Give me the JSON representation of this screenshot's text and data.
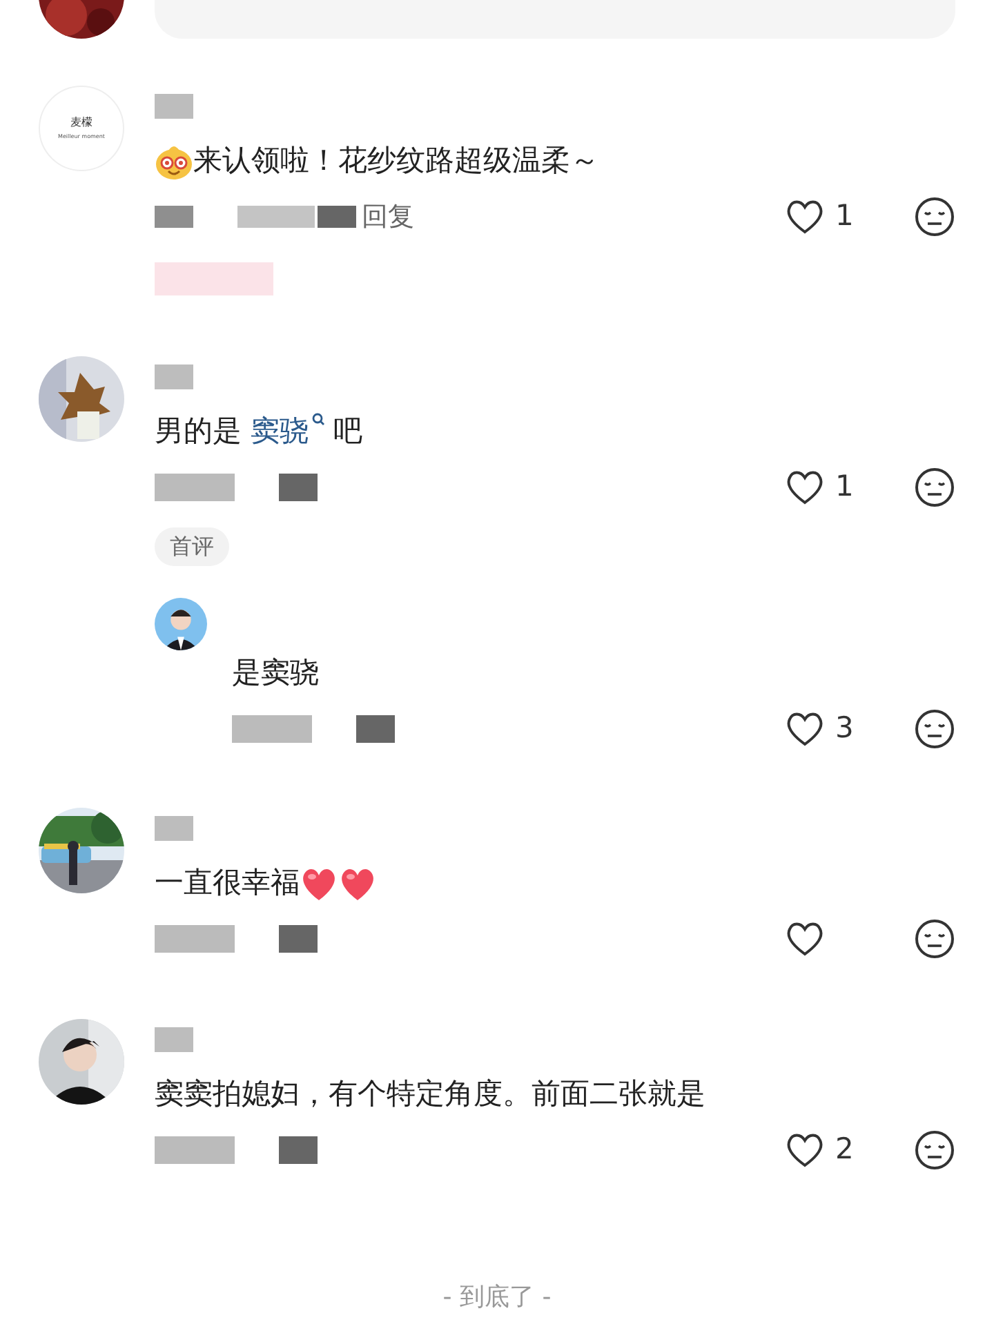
{
  "comments": [
    {
      "avatar": {
        "kind": "logo",
        "title": "麦檬",
        "subtitle": "Meilleur moment"
      },
      "segments": [
        {
          "kind": "emoji"
        },
        {
          "kind": "text",
          "text": "来认领啦！花纱纹路超级温柔～"
        }
      ],
      "meta": "回复",
      "likes": "1"
    },
    {
      "avatar": {
        "kind": "picture"
      },
      "segments": [
        {
          "kind": "text",
          "text": "男的是 "
        },
        {
          "kind": "link",
          "text": "窦骁"
        },
        {
          "kind": "text",
          "text": " 吧"
        }
      ],
      "likes": "1",
      "badge": "首评",
      "replies": [
        {
          "avatar": {
            "kind": "picture"
          },
          "segments": [
            {
              "kind": "text",
              "text": "是窦骁"
            }
          ],
          "likes": "3"
        }
      ]
    },
    {
      "avatar": {
        "kind": "picture"
      },
      "segments": [
        {
          "kind": "text",
          "text": "一直很幸福"
        },
        {
          "kind": "heart"
        },
        {
          "kind": "heart"
        }
      ]
    },
    {
      "avatar": {
        "kind": "picture"
      },
      "segments": [
        {
          "kind": "text",
          "text": "窦窦拍媳妇，有个特定角度。前面二张就是"
        }
      ],
      "likes": "2"
    }
  ],
  "footer": "- 到底了 -"
}
